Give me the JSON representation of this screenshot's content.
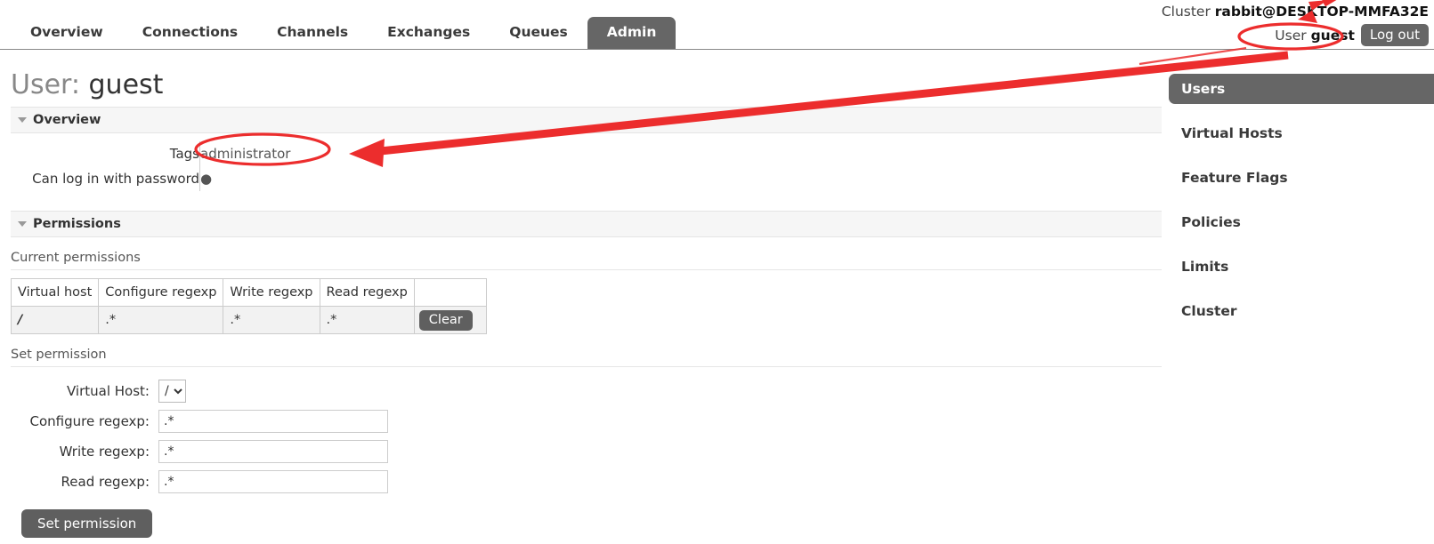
{
  "header": {
    "cluster_label": "Cluster",
    "cluster_name": "rabbit@DESKTOP-MMFA32E",
    "user_label": "User",
    "user_name": "guest",
    "logout_label": "Log out"
  },
  "nav": {
    "tabs": [
      {
        "label": "Overview",
        "active": false
      },
      {
        "label": "Connections",
        "active": false
      },
      {
        "label": "Channels",
        "active": false
      },
      {
        "label": "Exchanges",
        "active": false
      },
      {
        "label": "Queues",
        "active": false
      },
      {
        "label": "Admin",
        "active": true
      }
    ]
  },
  "page": {
    "title_prefix": "User:",
    "title_value": "guest"
  },
  "overview": {
    "section_label": "Overview",
    "rows": [
      {
        "label": "Tags",
        "value": "administrator"
      },
      {
        "label": "Can log in with password",
        "value": "●"
      }
    ]
  },
  "permissions": {
    "section_label": "Permissions",
    "current_label": "Current permissions",
    "table": {
      "headers": [
        "Virtual host",
        "Configure regexp",
        "Write regexp",
        "Read regexp",
        ""
      ],
      "rows": [
        {
          "virtual_host": "/",
          "configure": ".*",
          "write": ".*",
          "read": ".*",
          "action_label": "Clear"
        }
      ]
    },
    "set_label": "Set permission",
    "form": {
      "vhost_label": "Virtual Host:",
      "vhost_value": "/",
      "vhost_options": [
        "/"
      ],
      "configure_label": "Configure regexp:",
      "configure_value": ".*",
      "write_label": "Write regexp:",
      "write_value": ".*",
      "read_label": "Read regexp:",
      "read_value": ".*",
      "submit_label": "Set permission"
    }
  },
  "sidebar": {
    "items": [
      {
        "label": "Users",
        "active": true
      },
      {
        "label": "Virtual Hosts",
        "active": false
      },
      {
        "label": "Feature Flags",
        "active": false
      },
      {
        "label": "Policies",
        "active": false
      },
      {
        "label": "Limits",
        "active": false
      },
      {
        "label": "Cluster",
        "active": false
      }
    ]
  },
  "annotations": {
    "color": "#ec2d2d",
    "ellipse_user_guest": "highlight around User guest",
    "ellipse_tags": "highlight around administrator tag value",
    "arrow": "arrow from User guest down-left to administrator tag"
  }
}
